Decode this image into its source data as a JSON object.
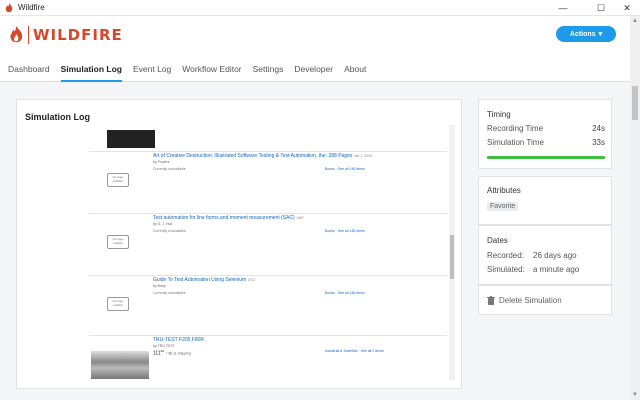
{
  "window": {
    "title": "Wildfire"
  },
  "header": {
    "logo_text": "WILDFIRE",
    "actions_label": "Actions"
  },
  "nav": {
    "items": [
      {
        "label": "Dashboard",
        "active": false
      },
      {
        "label": "Simulation Log",
        "active": true
      },
      {
        "label": "Event Log",
        "active": false
      },
      {
        "label": "Workflow Editor",
        "active": false
      },
      {
        "label": "Settings",
        "active": false
      },
      {
        "label": "Developer",
        "active": false
      },
      {
        "label": "About",
        "active": false
      }
    ]
  },
  "main": {
    "title": "Simulation Log",
    "log": {
      "items": [
        {
          "image_text": "No image available",
          "title": "Art of Creative Destruction: Illustrated Software Testing & Test Automation, the. 288 Pages",
          "date": "Jan 1, 2000",
          "author": "by Powers",
          "availability": "Currently unavailable",
          "format": "Books",
          "more": "See all 145 items"
        },
        {
          "image_text": "No image available",
          "title": "Test automation for line forms and moment measurement (SAC)",
          "date": "1987",
          "author": "by G. J. Huk",
          "availability": "Currently unavailable",
          "format": "Books",
          "more": "See all 145 items"
        },
        {
          "image_text": "No image available",
          "title": "Guide To Test Automation Using Selenium",
          "date": "2012",
          "author": "by Bahy",
          "availability": "Currently unavailable",
          "format": "Books",
          "more": "See all 145 items"
        },
        {
          "title": "TRU-TEST F205 F80R",
          "author": "by TRU-TEST",
          "price_main": "111",
          "price_cents": "69",
          "shipping": "+ $6.11 shipping",
          "format": "Industrial & Scientific",
          "more": "See all 2 items"
        }
      ]
    }
  },
  "timing": {
    "title": "Timing",
    "recording_label": "Recording Time",
    "recording_value": "24s",
    "simulation_label": "Simulation Time",
    "simulation_value": "33s"
  },
  "attributes": {
    "title": "Attributes",
    "tag": "Favorite"
  },
  "dates": {
    "title": "Dates",
    "recorded_label": "Recorded:",
    "recorded_value": "26 days ago",
    "simulated_label": "Simulated:",
    "simulated_value": "a minute ago"
  },
  "delete": {
    "label": "Delete Simulation"
  },
  "colors": {
    "accent": "#1e9be8",
    "brand": "#d9472b",
    "progress": "#3ebd3e"
  }
}
